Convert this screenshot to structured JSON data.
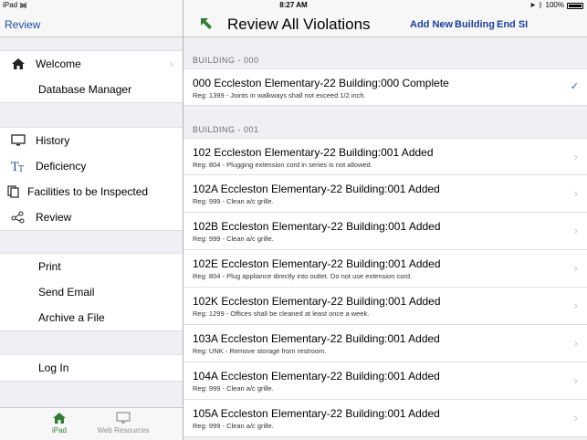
{
  "status": {
    "device": "iPad",
    "time": "8:27 AM",
    "battery": "100%"
  },
  "master": {
    "back_label": "Review",
    "groups": [
      [
        {
          "label": "Welcome",
          "icon": "house-icon",
          "chevron": true
        },
        {
          "label": "Database Manager",
          "icon": "",
          "chevron": false
        }
      ],
      [
        {
          "label": "History",
          "icon": "monitor-icon",
          "chevron": false
        },
        {
          "label": "Deficiency",
          "icon": "text-size-icon",
          "chevron": false
        },
        {
          "label": "Facilities to be Inspected",
          "icon": "copy-icon",
          "chevron": false
        },
        {
          "label": "Review",
          "icon": "share-nodes-icon",
          "chevron": false
        }
      ],
      [
        {
          "label": "Print",
          "icon": "",
          "chevron": false
        },
        {
          "label": "Send Email",
          "icon": "",
          "chevron": false
        },
        {
          "label": "Archive a File",
          "icon": "",
          "chevron": false
        }
      ],
      [
        {
          "label": "Log In",
          "icon": "",
          "chevron": false
        }
      ]
    ]
  },
  "tabbar": {
    "tabs": [
      {
        "label": "iPad",
        "icon": "house-icon",
        "active": true
      },
      {
        "label": "Web Resources",
        "icon": "monitor-icon",
        "active": false
      }
    ]
  },
  "detail": {
    "title": "Review All Violations",
    "buttons": {
      "add_new": "Add New",
      "building": "Building",
      "end_si": "End SI"
    },
    "sections": [
      {
        "header": "BUILDING  -  000",
        "rows": [
          {
            "title": "000  Eccleston Elementary-22   Building:000 Complete",
            "sub": "Reg: 1399 - Joints in walkways shall not exceed 1/2 inch.",
            "accessory": "check"
          }
        ]
      },
      {
        "header": "BUILDING  -  001",
        "rows": [
          {
            "title": "102  Eccleston Elementary-22   Building:001 Added",
            "sub": "Reg: 804 - Plugging extension cord in series is not allowed.",
            "accessory": "chevron"
          },
          {
            "title": "102A  Eccleston Elementary-22   Building:001 Added",
            "sub": "Reg: 999 - Clean a/c grille.",
            "accessory": "chevron"
          },
          {
            "title": "102B  Eccleston Elementary-22   Building:001 Added",
            "sub": "Reg: 999 - Clean a/c grille.",
            "accessory": "chevron"
          },
          {
            "title": "102E  Eccleston Elementary-22   Building:001 Added",
            "sub": "Reg: 804 - Plug appliance directly into outlet. Do not use extension cord.",
            "accessory": "chevron"
          },
          {
            "title": "102K  Eccleston Elementary-22   Building:001 Added",
            "sub": "Reg: 1299 - Offices shall be cleaned at least once a week.",
            "accessory": "chevron"
          },
          {
            "title": "103A  Eccleston Elementary-22   Building:001 Added",
            "sub": "Reg: UNK - Remove storage from restroom.",
            "accessory": "chevron"
          },
          {
            "title": "104A  Eccleston Elementary-22   Building:001 Added",
            "sub": "Reg: 999 - Clean a/c grille.",
            "accessory": "chevron"
          },
          {
            "title": "105A  Eccleston Elementary-22   Building:001 Added",
            "sub": "Reg: 999 - Clean a/c grille.",
            "accessory": "chevron"
          }
        ]
      }
    ]
  },
  "colors": {
    "link": "#1a4fa8",
    "accent_green": "#2e7d32",
    "check": "#1a6dd8"
  }
}
